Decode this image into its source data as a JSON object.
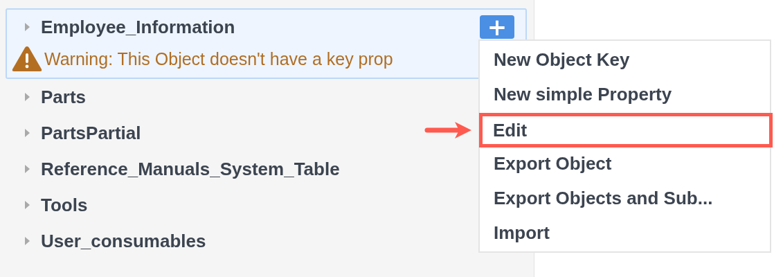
{
  "tree": {
    "items": [
      {
        "label": "Employee_Information",
        "selected": true,
        "expanded": false,
        "warning": "Warning: This Object doesn't have a key prop",
        "add_button": "+"
      },
      {
        "label": "Parts",
        "selected": false,
        "expanded": false
      },
      {
        "label": "PartsPartial",
        "selected": false,
        "expanded": false
      },
      {
        "label": "Reference_Manuals_System_Table",
        "selected": false,
        "expanded": false
      },
      {
        "label": "Tools",
        "selected": false,
        "expanded": false
      },
      {
        "label": "User_consumables",
        "selected": false,
        "expanded": false
      }
    ]
  },
  "context_menu": {
    "items": [
      {
        "label": "New Object Key",
        "highlighted": false
      },
      {
        "label": "New simple Property",
        "highlighted": false
      },
      {
        "label": "Edit",
        "highlighted": true
      },
      {
        "label": "Export Object",
        "highlighted": false
      },
      {
        "label": "Export Objects and Sub...",
        "highlighted": false
      },
      {
        "label": "Import",
        "highlighted": false
      }
    ]
  }
}
